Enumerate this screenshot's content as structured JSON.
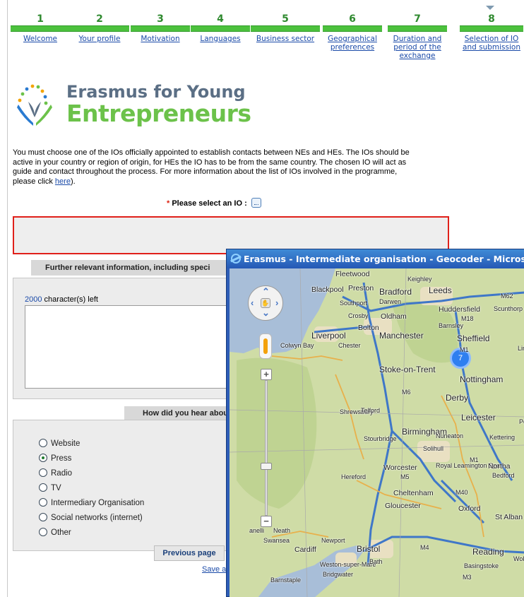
{
  "steps": [
    {
      "num": "1",
      "label": "Welcome"
    },
    {
      "num": "2",
      "label": "Your profile"
    },
    {
      "num": "3",
      "label": "Motivation"
    },
    {
      "num": "4",
      "label": "Languages"
    },
    {
      "num": "5",
      "label": "Business sector"
    },
    {
      "num": "6",
      "label": "Geographical preferences"
    },
    {
      "num": "7",
      "label": "Duration and period of the exchange"
    },
    {
      "num": "8",
      "label": "Selection of IO and submission"
    }
  ],
  "current_step": 8,
  "logo": {
    "line1": "Erasmus for Young",
    "line2": "Entrepreneurs"
  },
  "intro": {
    "text": "You must choose one of the IOs officially appointed to establish contacts between NEs and HEs. The IOs should be active in your country or region of origin, for HEs the IO has to be from the same country. The chosen IO will act as guide and contact throughout the process. For more information about the list of IOs involved in the programme, please click ",
    "link": "here",
    "tail": ")."
  },
  "select_io": {
    "required_mark": "*",
    "label": "Please select an IO :",
    "value": ""
  },
  "further_info": {
    "header": "Further relevant information, including speci",
    "chars_left": "2000",
    "chars_suffix": " character(s) left",
    "value": ""
  },
  "hear_about": {
    "header": "How did you hear abou",
    "options": [
      "Website",
      "Press",
      "Radio",
      "TV",
      "Intermediary Organisation",
      "Social networks (internet)",
      "Other"
    ],
    "selected": "Press"
  },
  "buttons": {
    "previous": "Previous page",
    "save": "Save a"
  },
  "popup": {
    "title": "Erasmus - Intermediate organisation - Geocoder - Microsoft In",
    "cluster_count": "7",
    "places": [
      "Fleetwood",
      "Keighley",
      "Blackpool",
      "Preston",
      "Bradford",
      "Leeds",
      "Southport",
      "Darwen",
      "M62",
      "Huddersfield",
      "Scunthorp",
      "Crosby",
      "Bolton",
      "Oldham",
      "M18",
      "Barnsley",
      "Liverpool",
      "Manchester",
      "Sheffield",
      "Colwyn Bay",
      "Chester",
      "M1",
      "Linco",
      "Stoke-on-Trent",
      "Nottingham",
      "M6",
      "Derby",
      "Shrewsbury",
      "Telford",
      "Leicester",
      "Pe",
      "Birmingham",
      "Stourbridge",
      "Nuneaton",
      "Kettering",
      "Solihull",
      "M1",
      "Worcester",
      "Royal Leamington Spa",
      "Northa",
      "Hereford",
      "M5",
      "Bedford",
      "Cheltenham",
      "M40",
      "Gloucester",
      "Oxford",
      "St Alban",
      "anelli",
      "Neath",
      "Newport",
      "Swansea",
      "Cardiff",
      "Bristol",
      "M4",
      "Reading",
      "Woki",
      "Weston-super-Mare",
      "Bath",
      "Basingstoke",
      "Bridgwater",
      "Barnstaple",
      "M3"
    ]
  },
  "colors": {
    "step_bar": "#4cc13d",
    "logo_grey": "#5b6f85",
    "logo_green": "#6cc24a",
    "error_border": "#e0201a",
    "link": "#1a4aa8",
    "title_bar": "#2558b5"
  }
}
